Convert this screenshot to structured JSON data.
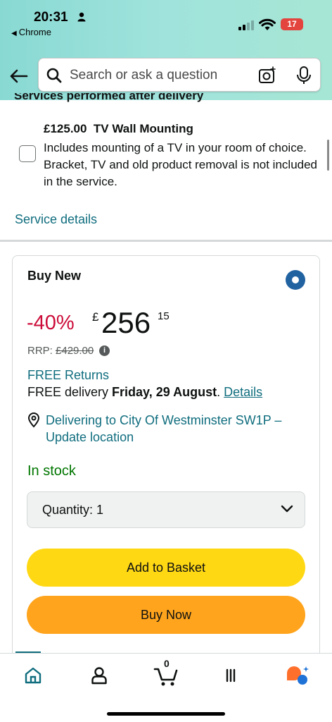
{
  "status_bar": {
    "time": "20:31",
    "back_app": "Chrome",
    "battery": "17"
  },
  "search": {
    "placeholder": "Search or ask a question"
  },
  "services": {
    "heading": "Services performed after delivery",
    "option_title": "£125.00  TV Wall Mounting",
    "option_description": "Includes mounting of a TV in your room of choice. Bracket, TV and old product removal is not included in the service.",
    "details_link": "Service details"
  },
  "offer": {
    "label": "Buy New",
    "discount": "-40%",
    "currency": "£",
    "price_whole": "256",
    "price_fraction": "15",
    "rrp_label": "RRP:",
    "rrp_value": "£429.00",
    "free_returns": "FREE Returns",
    "delivery_prefix": "FREE delivery",
    "delivery_date": "Friday, 29 August",
    "delivery_link": "Details",
    "location": "Delivering to City Of Westminster SW1P – Update location",
    "stock": "In stock",
    "quantity_label": "Quantity: 1",
    "add_to_basket": "Add to Basket",
    "buy_now": "Buy Now"
  },
  "bottom_nav": {
    "cart_count": "0",
    "items": [
      "home-icon",
      "account-icon",
      "cart-icon",
      "menu-icon",
      "rufus-icon"
    ]
  },
  "colors": {
    "header_teal": "#a0e3dc",
    "link": "#0f6d7e",
    "discount_red": "#cc0c39",
    "stock_green": "#007600",
    "basket_yellow": "#ffd814",
    "buy_orange": "#ffa41c",
    "radio_blue": "#2162a1"
  }
}
